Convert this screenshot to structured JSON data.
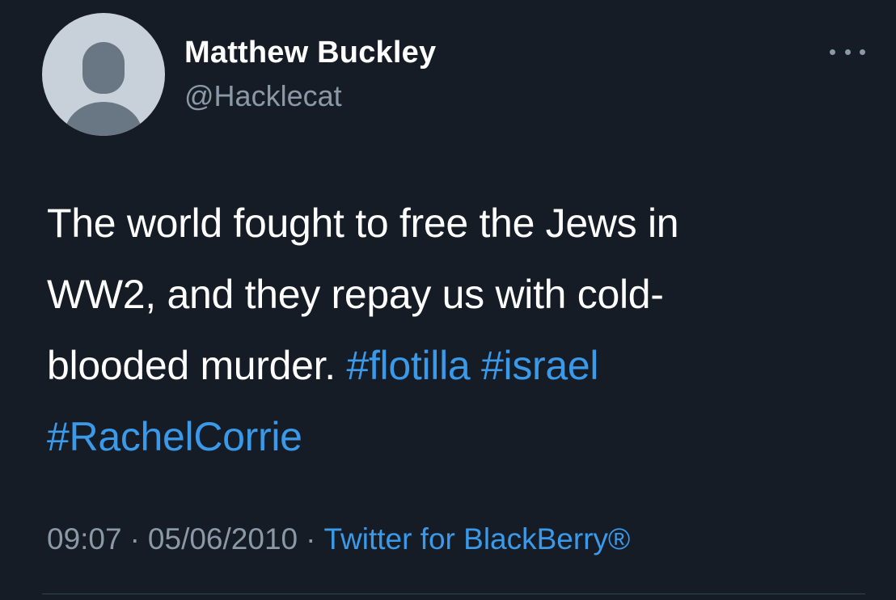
{
  "user": {
    "display_name": "Matthew Buckley",
    "handle": "@Hacklecat",
    "avatar_icon": "default-profile-silhouette"
  },
  "more_menu": {
    "icon": "ellipsis-icon"
  },
  "tweet": {
    "line1": "The world fought to free the Jews in",
    "line2": "WW2, and they repay us with cold-",
    "line3_text": "blooded murder.",
    "hashtags": [
      "#flotilla",
      "#israel",
      "#RachelCorrie"
    ]
  },
  "meta": {
    "time": "09:07",
    "separator": "·",
    "date": "05/06/2010",
    "source": "Twitter for BlackBerry®"
  },
  "colors": {
    "background": "#151c26",
    "text_primary": "#ffffff",
    "text_secondary": "#8b98a5",
    "link": "#3a9ae9"
  }
}
